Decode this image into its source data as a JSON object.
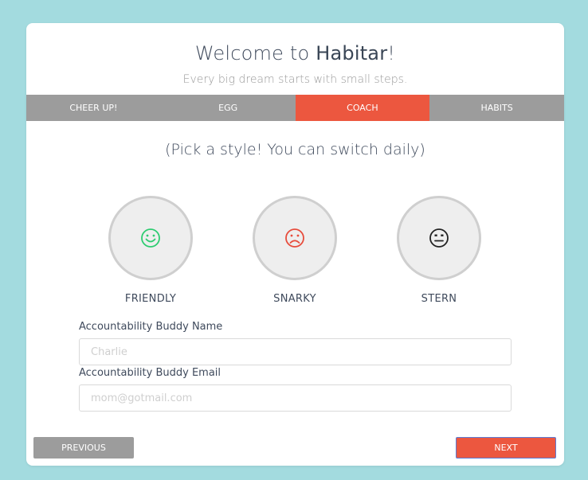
{
  "header": {
    "title_prefix": "Welcome to ",
    "title_brand": "Habitar",
    "title_suffix": "!",
    "subtitle": "Every big dream starts with small steps."
  },
  "tabs": [
    {
      "label": "CHEER UP!",
      "active": false
    },
    {
      "label": "EGG",
      "active": false
    },
    {
      "label": "COACH",
      "active": true
    },
    {
      "label": "HABITS",
      "active": false
    }
  ],
  "heading": "(Pick a style! You can switch daily)",
  "styles": [
    {
      "label": "FRIENDLY",
      "icon": "smile-icon",
      "color": "#2ecc71"
    },
    {
      "label": "SNARKY",
      "icon": "frown-icon",
      "color": "#e74c3c"
    },
    {
      "label": "STERN",
      "icon": "neutral-face-icon",
      "color": "#222222"
    }
  ],
  "form": {
    "buddy_name_label": "Accountability Buddy Name",
    "buddy_name_placeholder": "Charlie",
    "buddy_email_label": "Accountability Buddy Email",
    "buddy_email_placeholder": "mom@gotmail.com"
  },
  "buttons": {
    "previous": "PREVIOUS",
    "next": "NEXT"
  },
  "colors": {
    "background": "#a3dbdf",
    "accent": "#ec573f",
    "tab_bar": "#9c9c9c"
  }
}
